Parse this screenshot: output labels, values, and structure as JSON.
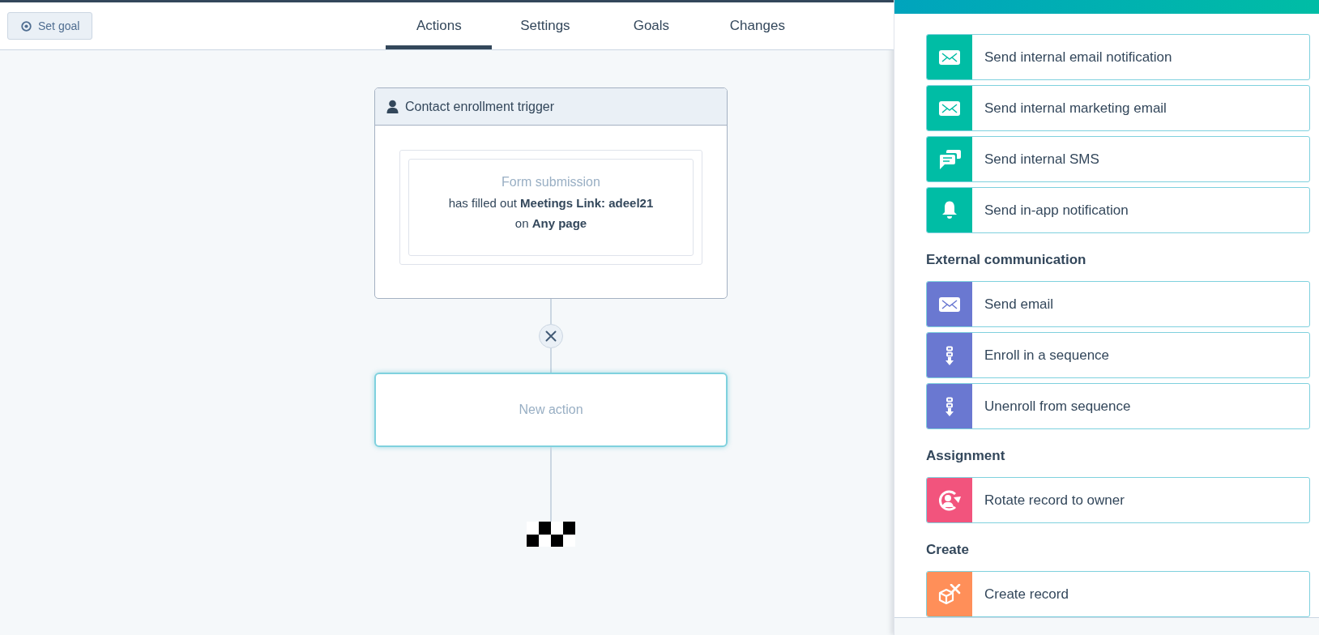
{
  "header": {
    "goal_button": "Set goal",
    "tabs": [
      {
        "label": "Actions",
        "selected": true
      },
      {
        "label": "Settings",
        "selected": false
      },
      {
        "label": "Goals",
        "selected": false
      },
      {
        "label": "Changes",
        "selected": false
      }
    ]
  },
  "workflow": {
    "trigger": {
      "title": "Contact enrollment trigger",
      "filter_type": "Form submission",
      "line_1": "has filled out **Meetings Link: adeel21**",
      "line_2": "on **Any page**"
    },
    "new_action": {
      "placeholder": "New action"
    }
  },
  "action_panel": {
    "sections": [
      {
        "items": [
          {
            "label": "Send internal email notification",
            "kind": "email",
            "color": "#00bda5"
          },
          {
            "label": "Send internal marketing email",
            "kind": "email",
            "color": "#00bda5"
          },
          {
            "label": "Send internal SMS",
            "kind": "chat",
            "color": "#00bda5"
          },
          {
            "label": "Send in-app notification",
            "kind": "bell",
            "color": "#00bda5"
          }
        ]
      },
      {
        "heading": "External communication",
        "items": [
          {
            "label": "Send email",
            "kind": "email",
            "color": "#6a78d1"
          },
          {
            "label": "Enroll in a sequence",
            "kind": "sequence",
            "color": "#6a78d1"
          },
          {
            "label": "Unenroll from sequence",
            "kind": "sequence",
            "color": "#6a78d1"
          }
        ]
      },
      {
        "heading": "Assignment",
        "items": [
          {
            "label": "Rotate record to owner",
            "kind": "rotate",
            "color": "#f2547d"
          }
        ]
      },
      {
        "heading": "Create",
        "items": [
          {
            "label": "Create record",
            "kind": "box",
            "color": "#ff8f59"
          }
        ]
      }
    ]
  }
}
